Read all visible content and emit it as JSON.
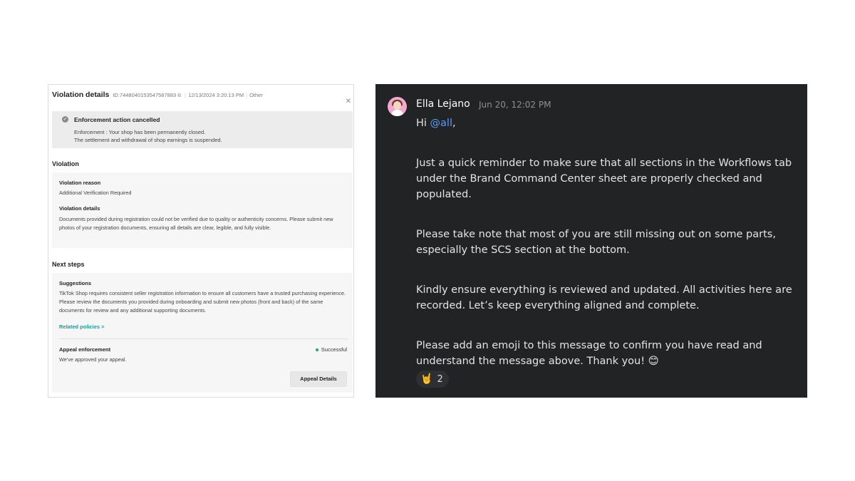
{
  "violation": {
    "title": "Violation details",
    "id": "ID:7448040153547587883",
    "date": "12/13/2024 3:20:13 PM",
    "category": "Other",
    "banner": {
      "title": "Enforcement action cancelled",
      "line1": "Enforcement : Your shop has been permanently closed.",
      "line2": "The settlement and withdrawal of shop earnings is suspended."
    },
    "violation_section": {
      "heading": "Violation",
      "reason_label": "Violation reason",
      "reason_value": "Additional Verification Required",
      "details_label": "Violation details",
      "details_value": "Documents provided during registration could not be verified due to quality or authenticity concerns. Please submit new photos of your registration documents, ensuring all details are clear, legible, and fully visible."
    },
    "next_steps": {
      "heading": "Next steps",
      "suggestions_label": "Suggestions",
      "suggestions_text": "TikTok Shop requires consistent seller registration information to ensure all customers have a trusted purchasing experience. Please review the documents you provided during onboarding and submit new photos (front and back) of the same documents for review and any additional supporting documents.",
      "related_link": "Related policies >",
      "appeal_label": "Appeal enforcement",
      "appeal_status": "Successful",
      "appeal_text": "We've approved your appeal.",
      "appeal_button": "Appeal Details"
    }
  },
  "chat": {
    "author": "Ella Lejano",
    "timestamp": "Jun 20, 12:02 PM",
    "greeting_prefix": "Hi ",
    "mention": "@all",
    "greeting_suffix": ",",
    "paragraphs": [
      "Just a quick reminder to make sure that all sections in the Workflows tab under the Brand Command Center sheet are properly checked and populated.",
      "Please take note that most of you are still missing out on some parts, especially the SCS section at the bottom.",
      "Kindly ensure everything is reviewed and updated. All activities here are recorded. Let’s keep everything aligned and complete.",
      "Please add an emoji to this message to confirm you have read and understand the message above. Thank you! 😊"
    ],
    "reaction": {
      "emoji": "🤘",
      "count": "2"
    }
  }
}
